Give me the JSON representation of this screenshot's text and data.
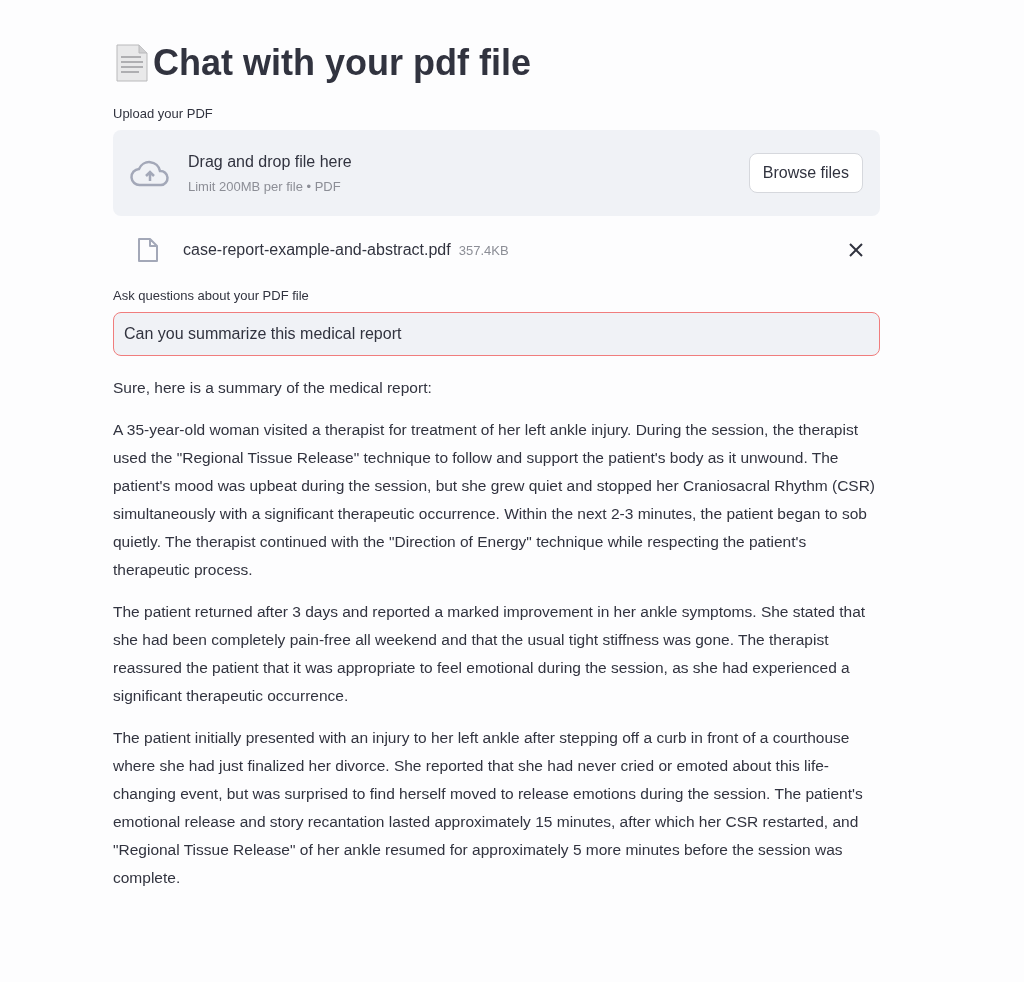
{
  "title": "Chat with your pdf file",
  "uploader": {
    "label": "Upload your PDF",
    "dropzone_text": "Drag and drop file here",
    "limit_text": "Limit 200MB per file • PDF",
    "button": "Browse files"
  },
  "file": {
    "name": "case-report-example-and-abstract.pdf",
    "size": "357.4KB"
  },
  "question": {
    "label": "Ask questions about your PDF file",
    "value": "Can you summarize this medical report",
    "focused": true
  },
  "answer": [
    "Sure, here is a summary of the medical report:",
    "A 35-year-old woman visited a therapist for treatment of her left ankle injury. During the session, the therapist used the \"Regional Tissue Release\" technique to follow and support the patient's body as it unwound. The patient's mood was upbeat during the session, but she grew quiet and stopped her Craniosacral Rhythm (CSR) simultaneously with a significant therapeutic occurrence. Within the next 2-3 minutes, the patient began to sob quietly. The therapist continued with the \"Direction of Energy\" technique while respecting the patient's therapeutic process.",
    "The patient returned after 3 days and reported a marked improvement in her ankle symptoms. She stated that she had been completely pain-free all weekend and that the usual tight stiffness was gone. The therapist reassured the patient that it was appropriate to feel emotional during the session, as she had experienced a significant therapeutic occurrence.",
    "The patient initially presented with an injury to her left ankle after stepping off a curb in front of a courthouse where she had just finalized her divorce. She reported that she had never cried or emoted about this life-changing event, but was surprised to find herself moved to release emotions during the session. The patient's emotional release and story recantation lasted approximately 15 minutes, after which her CSR restarted, and \"Regional Tissue Release\" of her ankle resumed for approximately 5 more minutes before the session was complete."
  ]
}
